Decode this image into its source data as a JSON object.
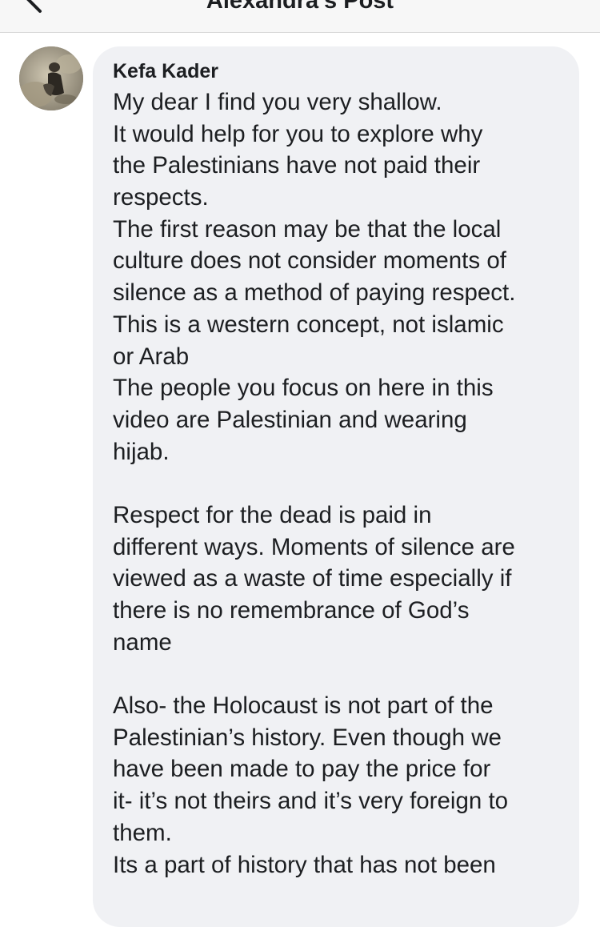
{
  "header": {
    "title": "Alexandra's Post"
  },
  "comment": {
    "author": "Kefa Kader",
    "lines": [
      "My dear I find you very shallow.",
      "It would help for you to explore why",
      "the Palestinians have not paid their",
      "respects.",
      "The first reason may be that the local",
      "culture does not consider moments of",
      "silence as a method of paying respect.",
      "This is a western concept, not islamic",
      "or Arab",
      "The people you focus on here in this",
      "video are Palestinian and wearing",
      "hijab.",
      "",
      "Respect for the dead is paid in",
      "different ways. Moments of silence are",
      "viewed as a waste of time especially if",
      "there is no remembrance of God’s",
      "name",
      "",
      "Also- the Holocaust is not part of the",
      "Palestinian’s history. Even though we",
      "have been made to pay the price for",
      "it- it’s not theirs and it’s very foreign to",
      "them.",
      "Its a part of history that has not been"
    ]
  }
}
